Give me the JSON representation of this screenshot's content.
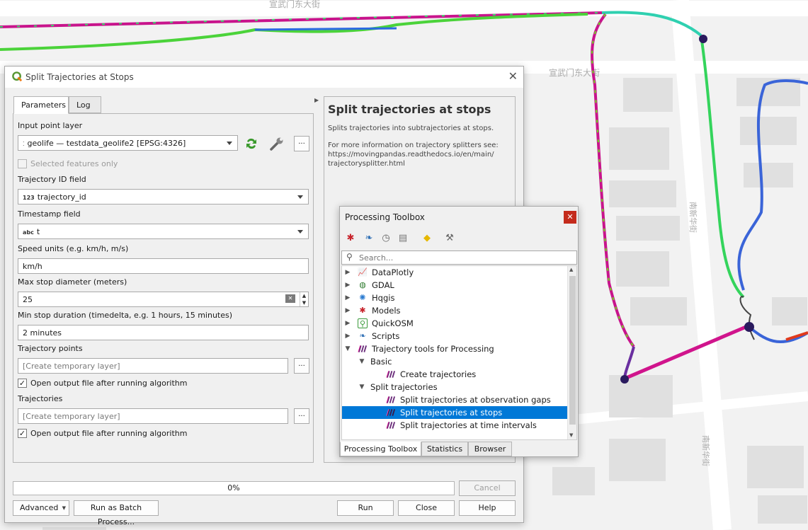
{
  "map": {
    "street_labels": [
      "宣武门东大街",
      "宣武门东大街",
      "南新华街",
      "南新华街"
    ]
  },
  "dialog": {
    "title": "Split Trajectories at Stops",
    "tabs": [
      "Parameters",
      "Log"
    ],
    "input_layer": {
      "label": "Input point layer",
      "value": "geolife — testdata_geolife2 [EPSG:4326]"
    },
    "selected_only": {
      "label": "Selected features only",
      "checked": false
    },
    "trajectory_id": {
      "label": "Trajectory ID field",
      "type": "123",
      "value": "trajectory_id"
    },
    "timestamp": {
      "label": "Timestamp field",
      "type": "abc",
      "value": "t"
    },
    "speed_units": {
      "label": "Speed units (e.g. km/h, m/s)",
      "value": "km/h"
    },
    "max_stop": {
      "label": "Max stop diameter (meters)",
      "value": "25"
    },
    "min_stop": {
      "label": "Min stop duration (timedelta, e.g. 1 hours, 15 minutes)",
      "value": "2 minutes"
    },
    "traj_points": {
      "label": "Trajectory points",
      "placeholder": "[Create temporary layer]",
      "open_label": "Open output file after running algorithm"
    },
    "trajectories": {
      "label": "Trajectories",
      "placeholder": "[Create temporary layer]",
      "open_label": "Open output file after running algorithm"
    },
    "ellipsis": "...",
    "help": {
      "title": "Split trajectories at stops",
      "desc": "Splits trajectories into subtrajectories at stops.",
      "more_1": "For more information on trajectory splitters see:",
      "more_2": "https://movingpandas.readthedocs.io/en/main/",
      "more_3": "trajectorysplitter.html"
    },
    "progress": {
      "text": "0%",
      "fraction": 0
    },
    "buttons": {
      "cancel": "Cancel",
      "advanced": "Advanced",
      "batch": "Run as Batch Process...",
      "run": "Run",
      "close": "Close",
      "help": "Help"
    }
  },
  "toolbox": {
    "title": "Processing Toolbox",
    "search_placeholder": "Search...",
    "tree": [
      {
        "label": "DataPlotly",
        "icon": "dataplotly-icon"
      },
      {
        "label": "GDAL",
        "icon": "gdal-icon"
      },
      {
        "label": "Hqgis",
        "icon": "hqgis-icon"
      },
      {
        "label": "Models",
        "icon": "models-icon"
      },
      {
        "label": "QuickOSM",
        "icon": "quickosm-icon"
      },
      {
        "label": "Scripts",
        "icon": "python-icon"
      },
      {
        "label": "Trajectory tools for Processing",
        "icon": "trajectory-icon"
      },
      {
        "label": "Basic"
      },
      {
        "label": "Create trajectories",
        "icon": "trajectory-icon"
      },
      {
        "label": "Split trajectories"
      },
      {
        "label": "Split trajectories at observation gaps",
        "icon": "trajectory-icon"
      },
      {
        "label": "Split trajectories at stops",
        "icon": "trajectory-icon",
        "selected": true
      },
      {
        "label": "Split trajectories at time intervals",
        "icon": "trajectory-icon"
      }
    ],
    "tabs": [
      "Processing Toolbox",
      "Statistics",
      "Browser"
    ]
  }
}
